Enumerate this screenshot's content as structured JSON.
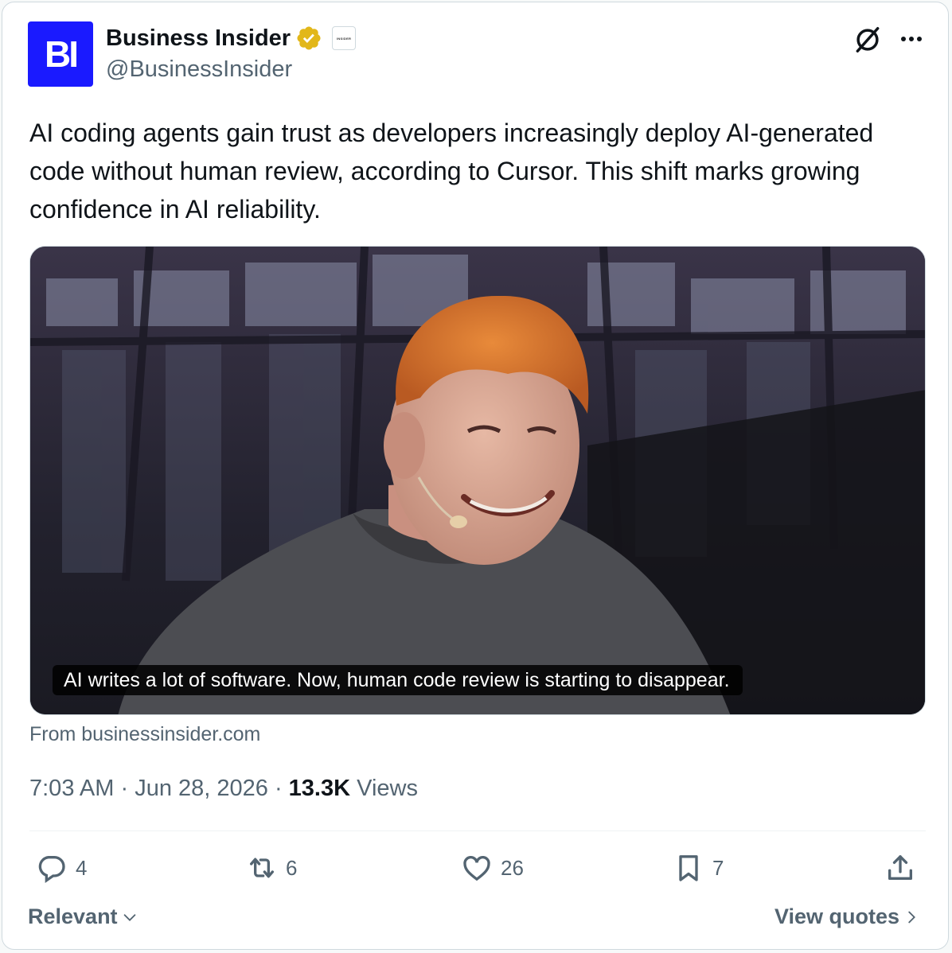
{
  "author": {
    "avatar_text": "BI",
    "name": "Business Insider",
    "handle": "@BusinessInsider",
    "affiliate_label": "INSIDER"
  },
  "tweet": {
    "text": "AI coding agents gain trust as developers increasingly deploy AI-generated code without human review, according to Cursor. This shift marks growing confidence in AI reliability."
  },
  "media": {
    "caption": "AI writes a lot of software. Now, human code review is starting to disappear."
  },
  "source_label": "From businessinsider.com",
  "meta": {
    "time": "7:03 AM",
    "separator": " · ",
    "date": "Jun 28, 2026",
    "views_count": "13.3K",
    "views_label": "Views"
  },
  "actions": {
    "replies": "4",
    "reposts": "6",
    "likes": "26",
    "bookmarks": "7"
  },
  "footer": {
    "sort_label": "Relevant",
    "quotes_label": "View quotes"
  },
  "colors": {
    "avatar_bg": "#1a1aff",
    "verified_gold": "#e2b719",
    "muted_text": "#536471",
    "primary_text": "#0f1419"
  },
  "icons": [
    "verified-gold-icon",
    "grok-icon",
    "more-icon",
    "reply-icon",
    "repost-icon",
    "like-icon",
    "bookmark-icon",
    "share-icon",
    "chevron-down-icon",
    "chevron-right-icon"
  ]
}
